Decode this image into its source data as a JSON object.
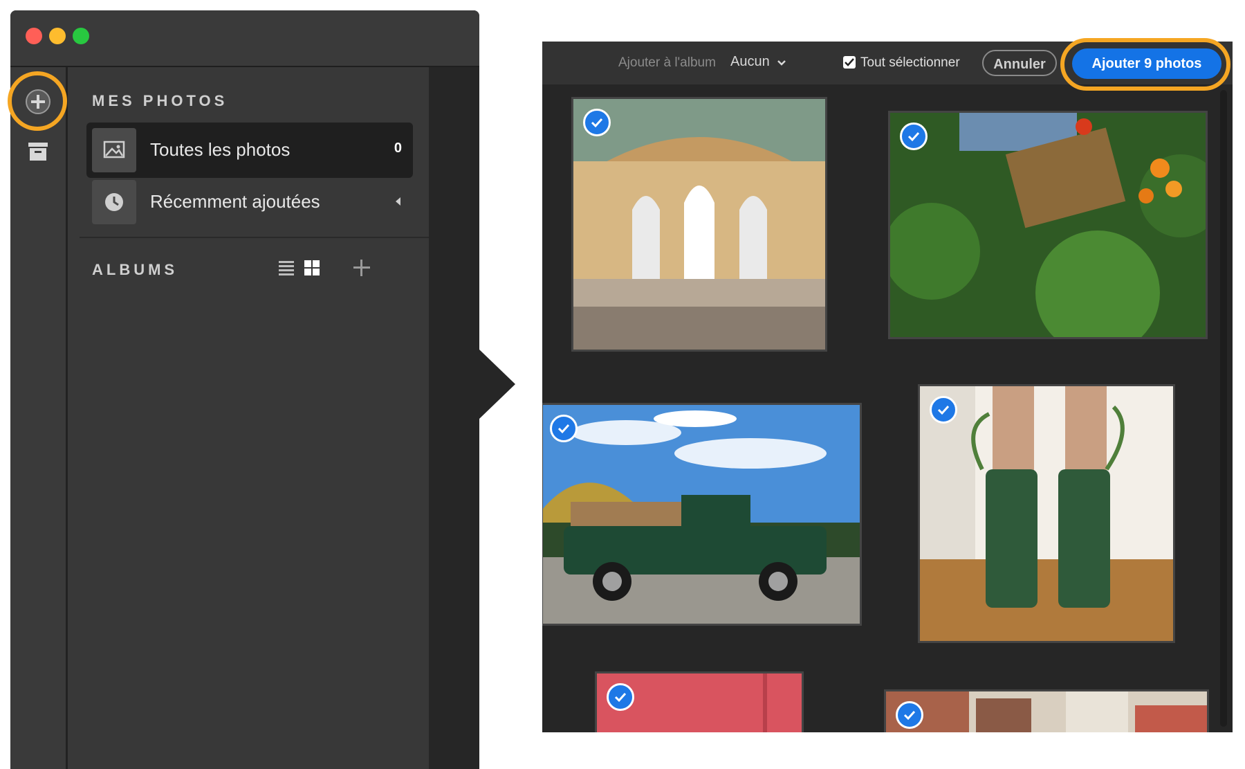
{
  "sidebar": {
    "my_photos_title": "MES PHOTOS",
    "items": [
      {
        "label": "Toutes les photos",
        "count": "0"
      },
      {
        "label": "Récemment ajoutées"
      }
    ],
    "albums_title": "ALBUMS"
  },
  "picker": {
    "add_to_album_label": "Ajouter à l'album",
    "album_value": "Aucun",
    "select_all_label": "Tout sélectionner",
    "cancel_label": "Annuler",
    "add_button_label": "Ajouter 9 photos"
  },
  "colors": {
    "accent_blue": "#1473e6",
    "highlight_orange": "#f5a623"
  },
  "icons": [
    "add-circle-icon",
    "archive-icon",
    "image-icon",
    "clock-icon",
    "list-view-icon",
    "grid-view-icon",
    "plus-icon",
    "chevron-down-icon",
    "checkmark-icon"
  ]
}
